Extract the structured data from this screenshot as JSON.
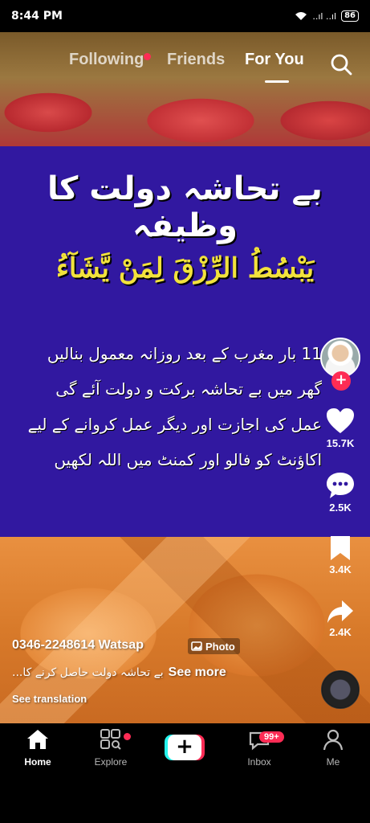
{
  "status_bar": {
    "time": "8:44 PM",
    "signal": "..ıl ..ıl",
    "battery": "86"
  },
  "top_nav": {
    "tabs": [
      "Following",
      "Friends",
      "For You"
    ],
    "active": "For You"
  },
  "post": {
    "title_urdu": "بے تحاشہ دولت کا وظیفہ",
    "arabic_verse": "يَبْسُطُ الرِّزْقَ لِمَنْ يَّشَآءُ",
    "lines": [
      "11 بار مغرب کے بعد روزانہ معمول بنالیں",
      "گھر میں بے تحاشہ برکت و دولت آئے گی",
      "عمل کی اجازت اور دیگر عمل کروانے کے لیے",
      "اکاؤنٹ کو فالو اور کمنٹ میں اللہ لکھیں"
    ]
  },
  "rail": {
    "likes": "15.7K",
    "comments": "2.5K",
    "saves": "3.4K",
    "shares": "2.4K",
    "follow": "+"
  },
  "caption": {
    "author": "0346-2248614 Watsap",
    "photo_tag": "Photo",
    "text": "بے تحاشہ دولت حاصل کرنے کا...",
    "see_more": "See more",
    "see_translation": "See translation"
  },
  "bottom_nav": {
    "home": "Home",
    "explore": "Explore",
    "create": "+",
    "inbox": "Inbox",
    "inbox_badge": "99+",
    "me": "Me"
  },
  "colors": {
    "accent": "#fe2c55",
    "panel": "#3118a0",
    "verse": "#f2e23c",
    "create_cyan": "#25f4ee"
  }
}
